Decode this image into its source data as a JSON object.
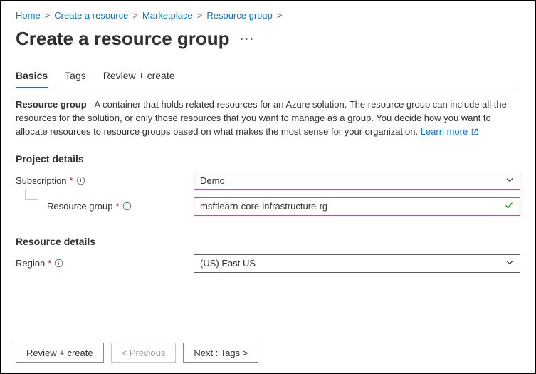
{
  "breadcrumb": {
    "items": [
      {
        "label": "Home"
      },
      {
        "label": "Create a resource"
      },
      {
        "label": "Marketplace"
      },
      {
        "label": "Resource group"
      }
    ]
  },
  "page": {
    "title": "Create a resource group"
  },
  "tabs": {
    "basics": "Basics",
    "tags": "Tags",
    "review": "Review + create"
  },
  "description": {
    "bold": "Resource group",
    "text": " - A container that holds related resources for an Azure solution. The resource group can include all the resources for the solution, or only those resources that you want to manage as a group. You decide how you want to allocate resources to resource groups based on what makes the most sense for your organization. ",
    "learn_more": "Learn more"
  },
  "sections": {
    "project_details": "Project details",
    "resource_details": "Resource details"
  },
  "fields": {
    "subscription": {
      "label": "Subscription",
      "value": "Demo"
    },
    "resource_group": {
      "label": "Resource group",
      "value": "msftlearn-core-infrastructure-rg"
    },
    "region": {
      "label": "Region",
      "value": "(US) East US"
    }
  },
  "footer": {
    "review_create": "Review + create",
    "previous": "< Previous",
    "next": "Next : Tags >"
  }
}
